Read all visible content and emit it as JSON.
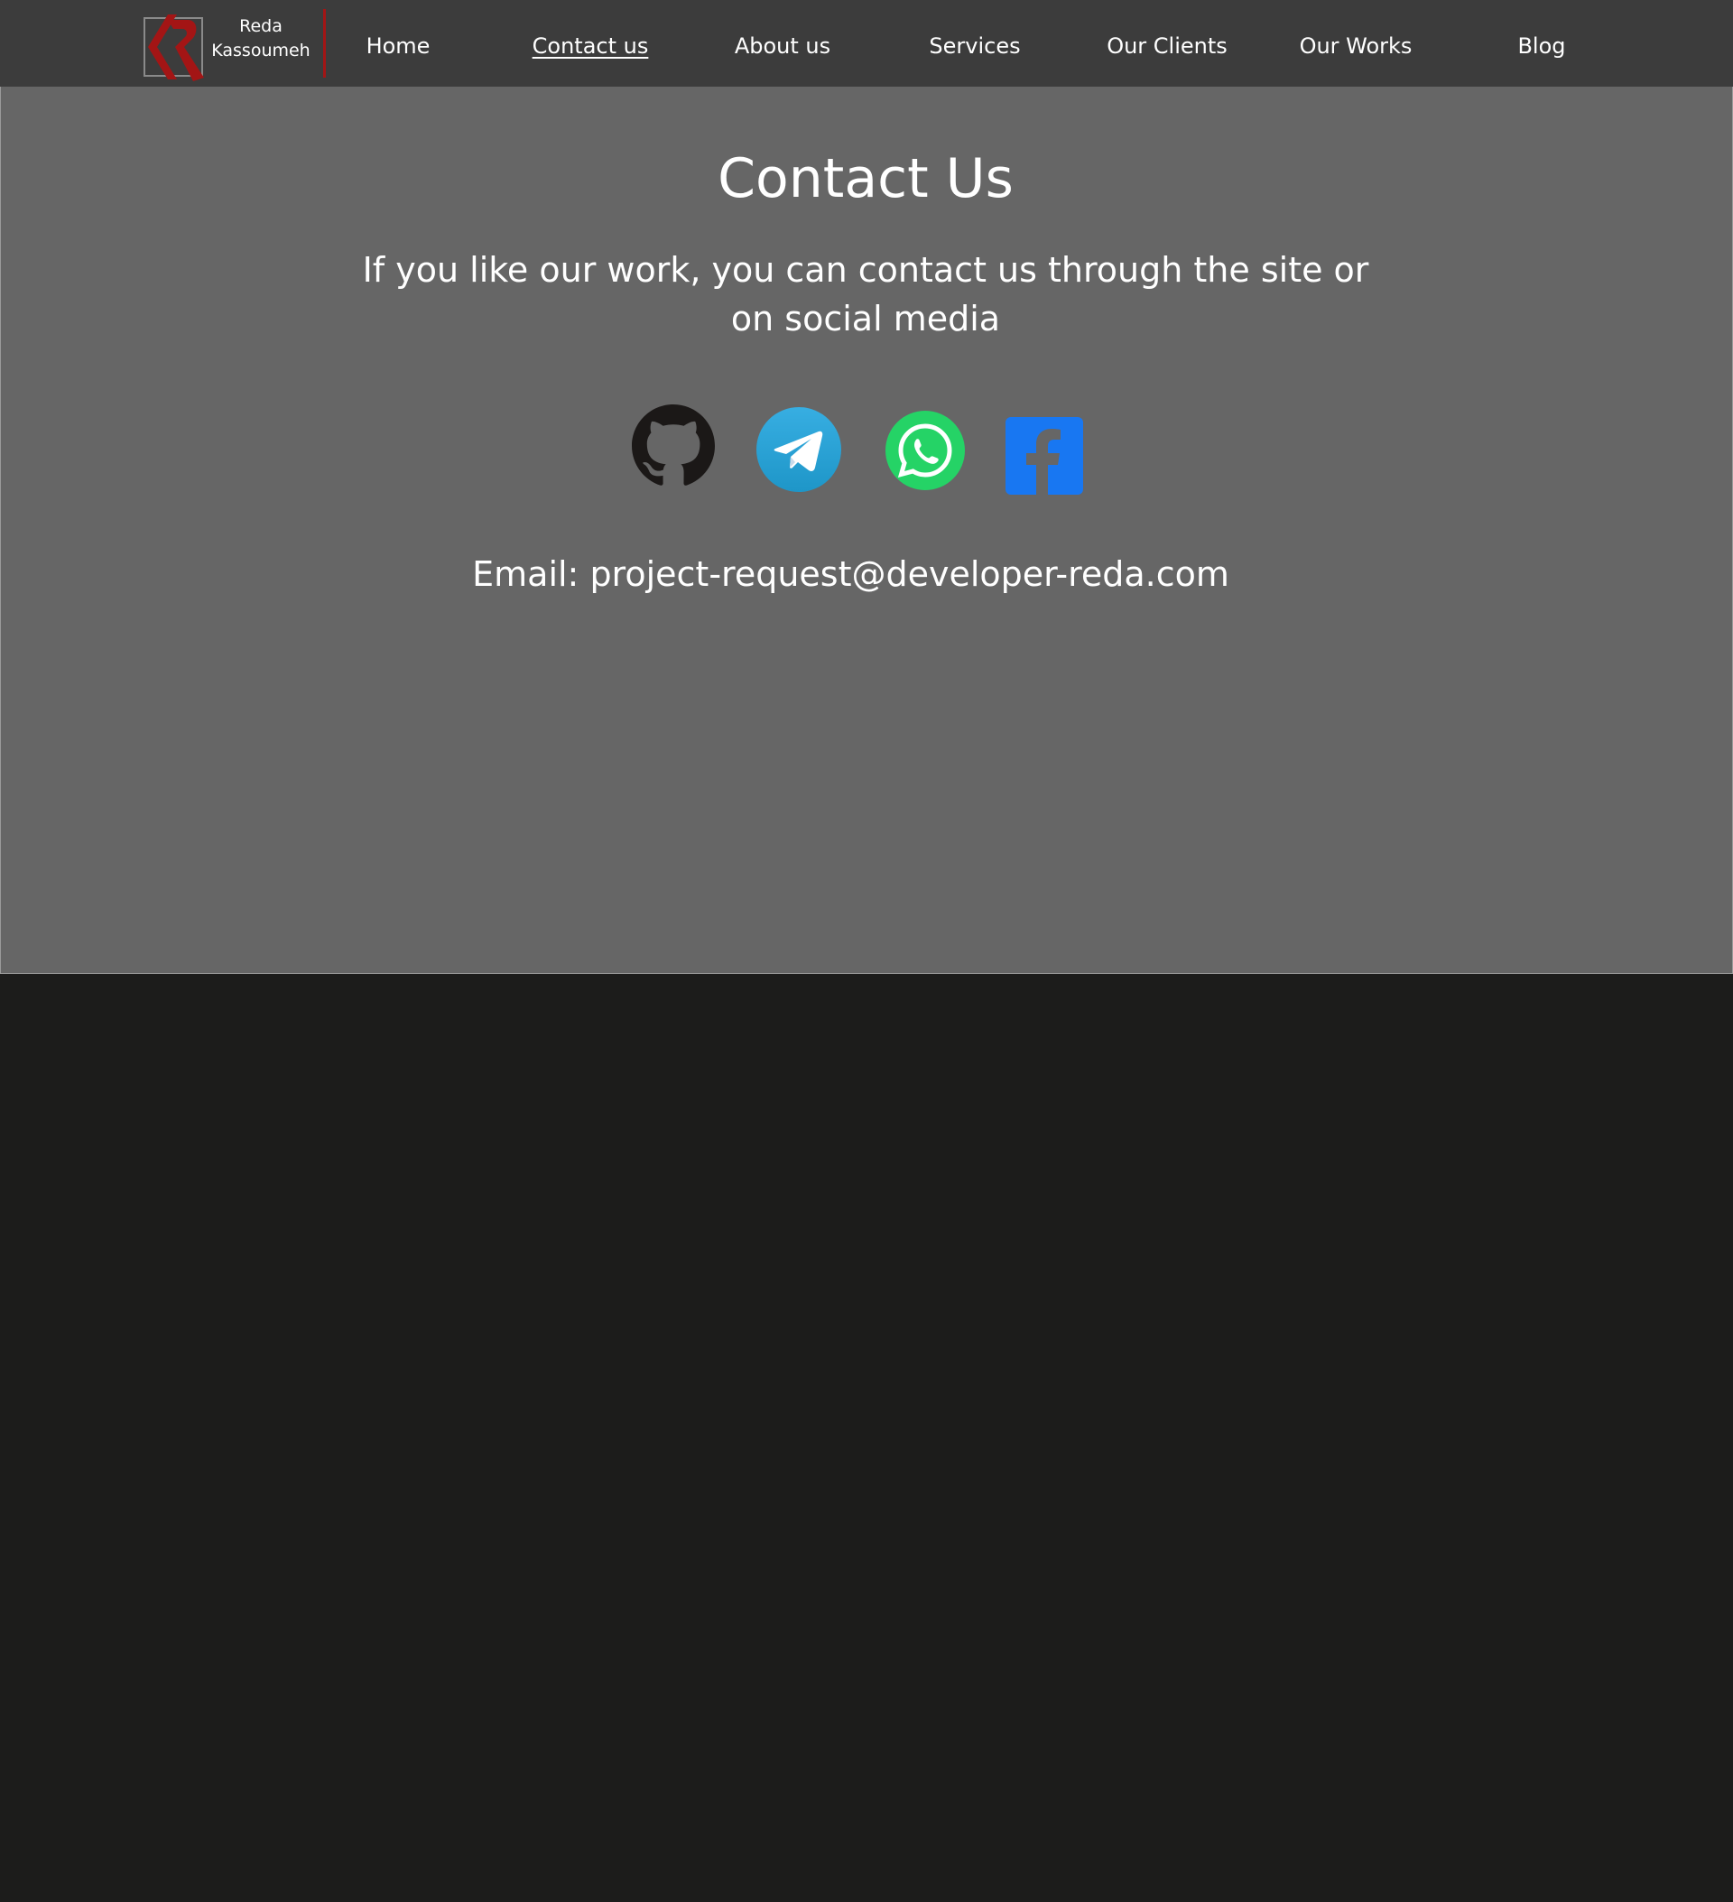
{
  "brand": {
    "line1": "Reda",
    "line2": "Kassoumeh",
    "accent_color": "#a31515"
  },
  "nav": {
    "items": [
      {
        "label": "Home",
        "active": false
      },
      {
        "label": "Contact us",
        "active": true
      },
      {
        "label": "About us",
        "active": false
      },
      {
        "label": "Services",
        "active": false
      },
      {
        "label": "Our Clients",
        "active": false
      },
      {
        "label": "Our Works",
        "active": false
      },
      {
        "label": "Blog",
        "active": false
      }
    ]
  },
  "main": {
    "title": "Contact Us",
    "subtitle": "If you like our work, you can contact us through the site or on social media",
    "social": [
      {
        "name": "github-icon",
        "color": "#1b1817"
      },
      {
        "name": "telegram-icon",
        "color": "#2aa3e0"
      },
      {
        "name": "whatsapp-icon",
        "color": "#25d366"
      },
      {
        "name": "facebook-icon",
        "color": "#1877f2"
      }
    ],
    "email_label": "Email: ",
    "email_value": "project-request@developer-reda.com"
  },
  "colors": {
    "header_bg": "#3c3c3c",
    "content_bg": "#666666",
    "page_bg": "#1c1c1b"
  }
}
